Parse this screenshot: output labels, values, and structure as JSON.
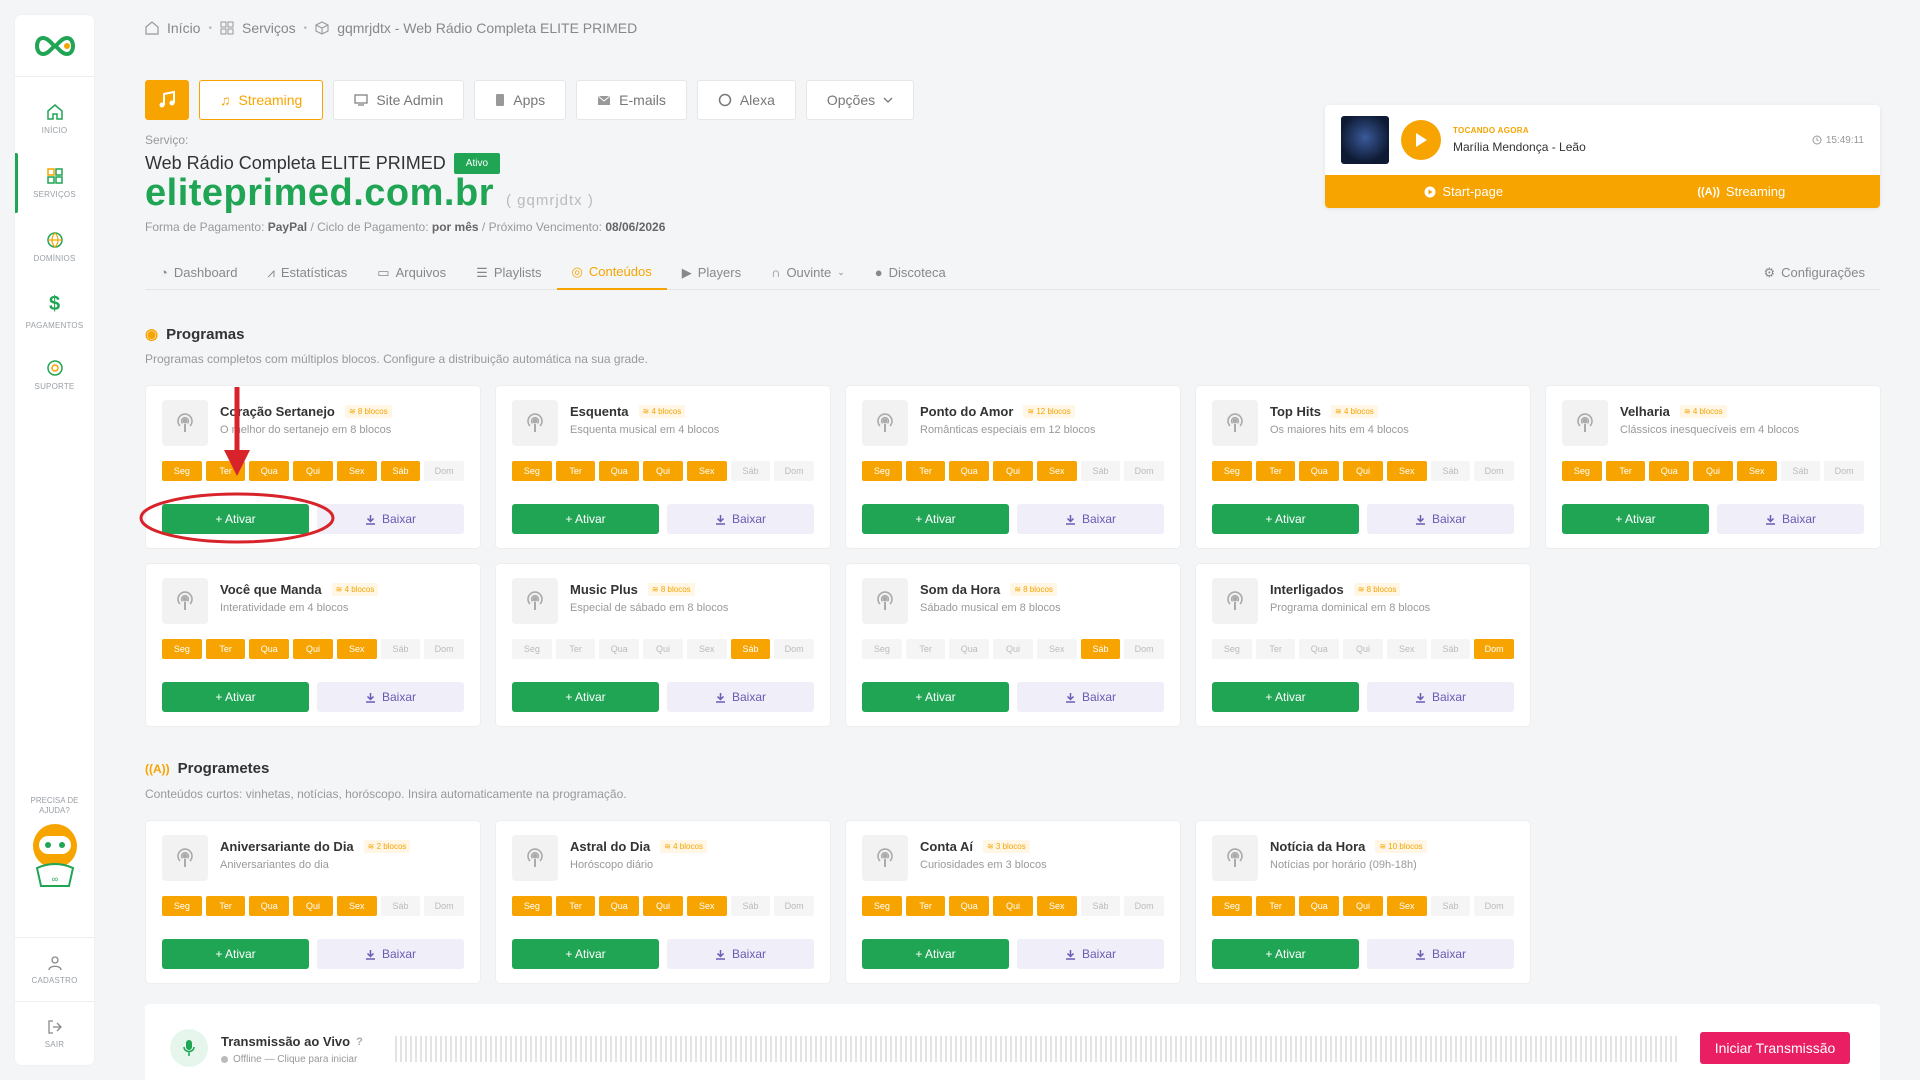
{
  "sidebar": {
    "items": [
      {
        "label": "INÍCIO",
        "icon": "home-icon"
      },
      {
        "label": "SERVIÇOS",
        "icon": "grid-icon"
      },
      {
        "label": "DOMÍNIOS",
        "icon": "globe-icon"
      },
      {
        "label": "PAGAMENTOS",
        "icon": "dollar-icon"
      },
      {
        "label": "SUPORTE",
        "icon": "support-icon"
      }
    ],
    "help_line1": "PRECISA DE",
    "help_line2": "AJUDA?",
    "bottom": [
      {
        "label": "CADASTRO",
        "icon": "user-icon"
      },
      {
        "label": "SAIR",
        "icon": "logout-icon"
      }
    ]
  },
  "breadcrumb": [
    "Início",
    "Serviços",
    "gqmrjdtx - Web Rádio Completa ELITE PRIMED"
  ],
  "service_tabs": [
    "Streaming",
    "Site Admin",
    "Apps",
    "E-mails",
    "Alexa",
    "Opções"
  ],
  "service": {
    "label": "Serviço:",
    "name": "Web Rádio Completa ELITE PRIMED",
    "status": "Ativo",
    "domain": "eliteprimed.com.br",
    "id": "( gqmrjdtx )",
    "payment_label": "Forma de Pagamento:",
    "payment_value": "PayPal",
    "cycle_label": "/ Ciclo de Pagamento:",
    "cycle_value": "por mês",
    "due_label": "/ Próximo Vencimento:",
    "due_value": "08/06/2026"
  },
  "now_playing": {
    "tag": "TOCANDO AGORA",
    "song": "Marília Mendonça - Leão",
    "time": "15:49:11",
    "btn_startpage": "Start-page",
    "btn_streaming": "Streaming"
  },
  "sub_tabs": [
    "Dashboard",
    "Estatísticas",
    "Arquivos",
    "Playlists",
    "Conteúdos",
    "Players",
    "Ouvinte",
    "Discoteca",
    "Configurações"
  ],
  "programas": {
    "title": "Programas",
    "desc": "Programas completos com múltiplos blocos. Configure a distribuição automática na sua grade."
  },
  "programetes": {
    "title": "Programetes",
    "desc": "Conteúdos curtos: vinhetas, notícias, horóscopo. Insira automaticamente na programação."
  },
  "day_labels": [
    "Seg",
    "Ter",
    "Qua",
    "Qui",
    "Sex",
    "Sáb",
    "Dom"
  ],
  "btn_ativar": "+ Ativar",
  "btn_baixar": "Baixar",
  "cards": [
    {
      "title": "Coração Sertanejo",
      "blocks": "8 blocos",
      "sub": "O melhor do sertanejo em 8 blocos",
      "days": [
        1,
        1,
        1,
        1,
        1,
        1,
        0
      ]
    },
    {
      "title": "Esquenta",
      "blocks": "4 blocos",
      "sub": "Esquenta musical em 4 blocos",
      "days": [
        1,
        1,
        1,
        1,
        1,
        0,
        0
      ]
    },
    {
      "title": "Ponto do Amor",
      "blocks": "12 blocos",
      "sub": "Românticas especiais em 12 blocos",
      "days": [
        1,
        1,
        1,
        1,
        1,
        0,
        0
      ]
    },
    {
      "title": "Top Hits",
      "blocks": "4 blocos",
      "sub": "Os maiores hits em 4 blocos",
      "days": [
        1,
        1,
        1,
        1,
        1,
        0,
        0
      ]
    },
    {
      "title": "Velharia",
      "blocks": "4 blocos",
      "sub": "Clássicos inesquecíveis em 4 blocos",
      "days": [
        1,
        1,
        1,
        1,
        1,
        0,
        0
      ]
    },
    {
      "title": "Você que Manda",
      "blocks": "4 blocos",
      "sub": "Interatividade em 4 blocos",
      "days": [
        1,
        1,
        1,
        1,
        1,
        0,
        0
      ]
    },
    {
      "title": "Music Plus",
      "blocks": "8 blocos",
      "sub": "Especial de sábado em 8 blocos",
      "days": [
        0,
        0,
        0,
        0,
        0,
        1,
        0
      ]
    },
    {
      "title": "Som da Hora",
      "blocks": "8 blocos",
      "sub": "Sábado musical em 8 blocos",
      "days": [
        0,
        0,
        0,
        0,
        0,
        1,
        0
      ]
    },
    {
      "title": "Interligados",
      "blocks": "8 blocos",
      "sub": "Programa dominical em 8 blocos",
      "days": [
        0,
        0,
        0,
        0,
        0,
        0,
        1
      ]
    }
  ],
  "programete_cards": [
    {
      "title": "Aniversariante do Dia",
      "blocks": "2 blocos",
      "sub": "Aniversariantes do dia",
      "days": [
        1,
        1,
        1,
        1,
        1,
        0,
        0
      ]
    },
    {
      "title": "Astral do Dia",
      "blocks": "4 blocos",
      "sub": "Horóscopo diário",
      "days": [
        1,
        1,
        1,
        1,
        1,
        0,
        0
      ]
    },
    {
      "title": "Conta Aí",
      "blocks": "3 blocos",
      "sub": "Curiosidades em 3 blocos",
      "days": [
        1,
        1,
        1,
        1,
        1,
        0,
        0
      ]
    },
    {
      "title": "Notícia da Hora",
      "blocks": "10 blocos",
      "sub": "Notícias por horário (09h-18h)",
      "days": [
        1,
        1,
        1,
        1,
        1,
        0,
        0
      ]
    }
  ],
  "live": {
    "title": "Transmissão ao Vivo",
    "status": "Offline — Clique para iniciar",
    "button": "Iniciar Transmissão"
  },
  "colors": {
    "accent": "#f7a400",
    "green": "#1fa554",
    "pink": "#e91e63"
  }
}
